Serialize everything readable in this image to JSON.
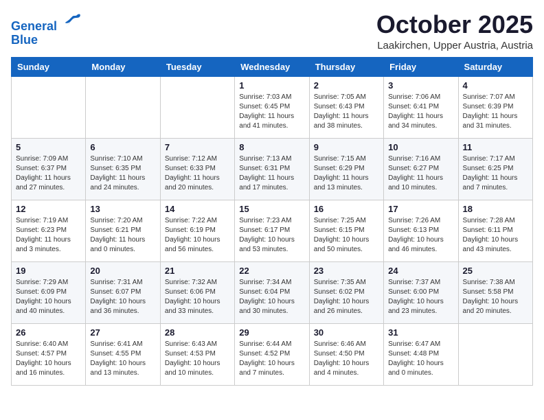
{
  "logo": {
    "line1": "General",
    "line2": "Blue"
  },
  "title": "October 2025",
  "subtitle": "Laakirchen, Upper Austria, Austria",
  "header_days": [
    "Sunday",
    "Monday",
    "Tuesday",
    "Wednesday",
    "Thursday",
    "Friday",
    "Saturday"
  ],
  "weeks": [
    [
      {
        "day": "",
        "info": ""
      },
      {
        "day": "",
        "info": ""
      },
      {
        "day": "",
        "info": ""
      },
      {
        "day": "1",
        "info": "Sunrise: 7:03 AM\nSunset: 6:45 PM\nDaylight: 11 hours\nand 41 minutes."
      },
      {
        "day": "2",
        "info": "Sunrise: 7:05 AM\nSunset: 6:43 PM\nDaylight: 11 hours\nand 38 minutes."
      },
      {
        "day": "3",
        "info": "Sunrise: 7:06 AM\nSunset: 6:41 PM\nDaylight: 11 hours\nand 34 minutes."
      },
      {
        "day": "4",
        "info": "Sunrise: 7:07 AM\nSunset: 6:39 PM\nDaylight: 11 hours\nand 31 minutes."
      }
    ],
    [
      {
        "day": "5",
        "info": "Sunrise: 7:09 AM\nSunset: 6:37 PM\nDaylight: 11 hours\nand 27 minutes."
      },
      {
        "day": "6",
        "info": "Sunrise: 7:10 AM\nSunset: 6:35 PM\nDaylight: 11 hours\nand 24 minutes."
      },
      {
        "day": "7",
        "info": "Sunrise: 7:12 AM\nSunset: 6:33 PM\nDaylight: 11 hours\nand 20 minutes."
      },
      {
        "day": "8",
        "info": "Sunrise: 7:13 AM\nSunset: 6:31 PM\nDaylight: 11 hours\nand 17 minutes."
      },
      {
        "day": "9",
        "info": "Sunrise: 7:15 AM\nSunset: 6:29 PM\nDaylight: 11 hours\nand 13 minutes."
      },
      {
        "day": "10",
        "info": "Sunrise: 7:16 AM\nSunset: 6:27 PM\nDaylight: 11 hours\nand 10 minutes."
      },
      {
        "day": "11",
        "info": "Sunrise: 7:17 AM\nSunset: 6:25 PM\nDaylight: 11 hours\nand 7 minutes."
      }
    ],
    [
      {
        "day": "12",
        "info": "Sunrise: 7:19 AM\nSunset: 6:23 PM\nDaylight: 11 hours\nand 3 minutes."
      },
      {
        "day": "13",
        "info": "Sunrise: 7:20 AM\nSunset: 6:21 PM\nDaylight: 11 hours\nand 0 minutes."
      },
      {
        "day": "14",
        "info": "Sunrise: 7:22 AM\nSunset: 6:19 PM\nDaylight: 10 hours\nand 56 minutes."
      },
      {
        "day": "15",
        "info": "Sunrise: 7:23 AM\nSunset: 6:17 PM\nDaylight: 10 hours\nand 53 minutes."
      },
      {
        "day": "16",
        "info": "Sunrise: 7:25 AM\nSunset: 6:15 PM\nDaylight: 10 hours\nand 50 minutes."
      },
      {
        "day": "17",
        "info": "Sunrise: 7:26 AM\nSunset: 6:13 PM\nDaylight: 10 hours\nand 46 minutes."
      },
      {
        "day": "18",
        "info": "Sunrise: 7:28 AM\nSunset: 6:11 PM\nDaylight: 10 hours\nand 43 minutes."
      }
    ],
    [
      {
        "day": "19",
        "info": "Sunrise: 7:29 AM\nSunset: 6:09 PM\nDaylight: 10 hours\nand 40 minutes."
      },
      {
        "day": "20",
        "info": "Sunrise: 7:31 AM\nSunset: 6:07 PM\nDaylight: 10 hours\nand 36 minutes."
      },
      {
        "day": "21",
        "info": "Sunrise: 7:32 AM\nSunset: 6:06 PM\nDaylight: 10 hours\nand 33 minutes."
      },
      {
        "day": "22",
        "info": "Sunrise: 7:34 AM\nSunset: 6:04 PM\nDaylight: 10 hours\nand 30 minutes."
      },
      {
        "day": "23",
        "info": "Sunrise: 7:35 AM\nSunset: 6:02 PM\nDaylight: 10 hours\nand 26 minutes."
      },
      {
        "day": "24",
        "info": "Sunrise: 7:37 AM\nSunset: 6:00 PM\nDaylight: 10 hours\nand 23 minutes."
      },
      {
        "day": "25",
        "info": "Sunrise: 7:38 AM\nSunset: 5:58 PM\nDaylight: 10 hours\nand 20 minutes."
      }
    ],
    [
      {
        "day": "26",
        "info": "Sunrise: 6:40 AM\nSunset: 4:57 PM\nDaylight: 10 hours\nand 16 minutes."
      },
      {
        "day": "27",
        "info": "Sunrise: 6:41 AM\nSunset: 4:55 PM\nDaylight: 10 hours\nand 13 minutes."
      },
      {
        "day": "28",
        "info": "Sunrise: 6:43 AM\nSunset: 4:53 PM\nDaylight: 10 hours\nand 10 minutes."
      },
      {
        "day": "29",
        "info": "Sunrise: 6:44 AM\nSunset: 4:52 PM\nDaylight: 10 hours\nand 7 minutes."
      },
      {
        "day": "30",
        "info": "Sunrise: 6:46 AM\nSunset: 4:50 PM\nDaylight: 10 hours\nand 4 minutes."
      },
      {
        "day": "31",
        "info": "Sunrise: 6:47 AM\nSunset: 4:48 PM\nDaylight: 10 hours\nand 0 minutes."
      },
      {
        "day": "",
        "info": ""
      }
    ]
  ]
}
